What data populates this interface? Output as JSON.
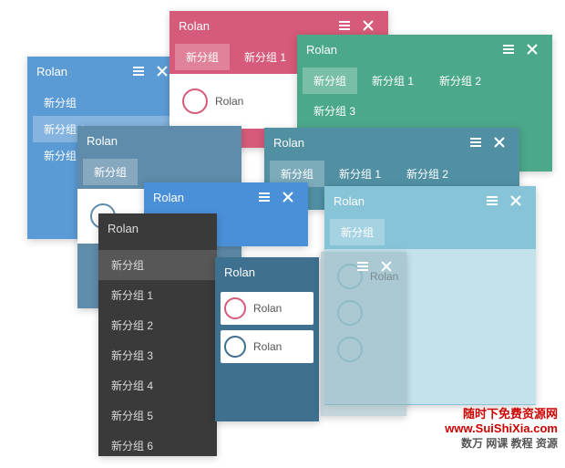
{
  "app_title": "Rolan",
  "tabs": {
    "base": "新分组",
    "n1": "新分组 1",
    "n2": "新分组 2",
    "n3": "新分组 3",
    "n4": "新分组 4",
    "n5": "新分组 5",
    "n6": "新分组 6"
  },
  "item_label": "Rolan",
  "watermark": {
    "line1": "随时下免费资源网",
    "line2": "www.SuiShiXia.com",
    "line3": "数万 网课 教程 资源"
  },
  "colors": {
    "blue": "#5b9bd5",
    "pink": "#d65a79",
    "green": "#4ca88a",
    "teal": "#518fa3",
    "steel": "#5f8caa",
    "dark": "#3a3a3a",
    "navy": "#3e7090",
    "sky": "#87c4d8"
  }
}
